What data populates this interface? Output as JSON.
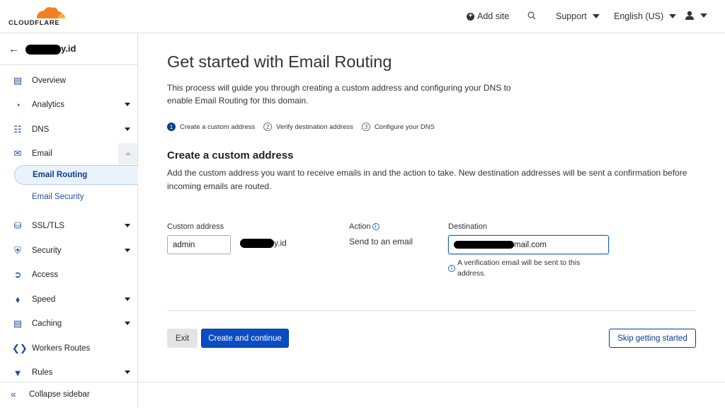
{
  "header": {
    "logo_text": "CLOUDFLARE",
    "add_site": "Add site",
    "support": "Support",
    "language": "English (US)",
    "colors": {
      "logo_orange": "#f38020",
      "logo_light": "#faae40"
    }
  },
  "sidebar": {
    "domain_suffix": "y.id",
    "items": [
      {
        "label": "Overview",
        "icon": "document-icon"
      },
      {
        "label": "Analytics",
        "icon": "chart-icon"
      },
      {
        "label": "DNS",
        "icon": "network-icon"
      },
      {
        "label": "Email",
        "icon": "envelope-icon"
      },
      {
        "label": "Email Routing",
        "active": true
      },
      {
        "label": "Email Security"
      },
      {
        "label": "SSL/TLS",
        "icon": "lock-icon"
      },
      {
        "label": "Security",
        "icon": "shield-icon"
      },
      {
        "label": "Access",
        "icon": "access-icon"
      },
      {
        "label": "Speed",
        "icon": "lightning-icon"
      },
      {
        "label": "Caching",
        "icon": "storage-icon"
      },
      {
        "label": "Workers Routes",
        "icon": "workers-icon"
      },
      {
        "label": "Rules",
        "icon": "funnel-icon"
      }
    ],
    "collapse_label": "Collapse sidebar"
  },
  "main": {
    "title": "Get started with Email Routing",
    "intro": "This process will guide you through creating a custom address and configuring your DNS to enable Email Routing for this domain.",
    "steps": [
      {
        "num": "1",
        "label": "Create a custom address",
        "active": true
      },
      {
        "num": "2",
        "label": "Verify destination address"
      },
      {
        "num": "3",
        "label": "Configure your DNS"
      }
    ],
    "section_title": "Create a custom address",
    "section_desc": "Add the custom address you want to receive emails in and the action to take. New destination addresses will be sent a confirmation before incoming emails are routed.",
    "custom_address_label": "Custom address",
    "custom_address_value": "admin",
    "domain_suffix": "y.id",
    "action_label": "Action",
    "action_value": "Send to an email",
    "destination_label": "Destination",
    "destination_suffix": "mail.com",
    "verification_note": "A verification email will be sent to this address.",
    "exit_label": "Exit",
    "create_label": "Create and continue",
    "skip_label": "Skip getting started"
  }
}
